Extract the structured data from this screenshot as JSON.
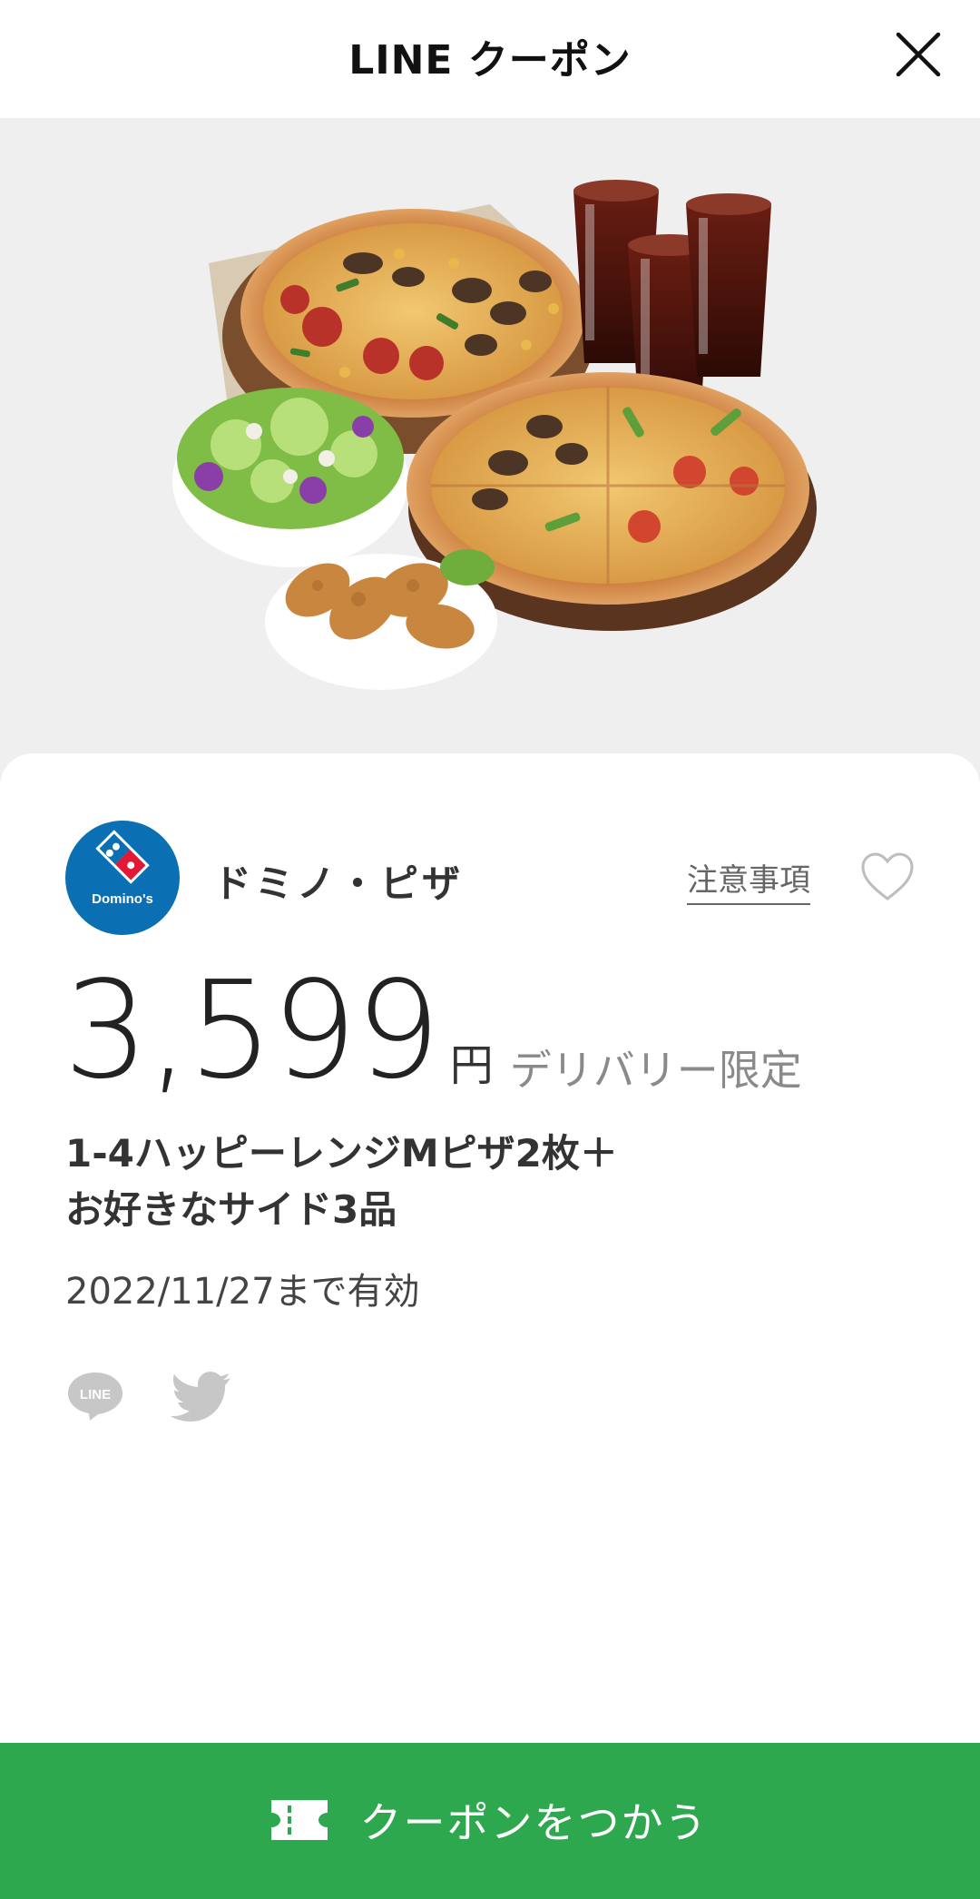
{
  "header": {
    "title": "LINE クーポン"
  },
  "hero": {
    "image": "pizza-set-photo"
  },
  "store": {
    "logo_text": "Domino's",
    "name": "ドミノ・ピザ"
  },
  "notice_label": "注意事項",
  "coupon": {
    "price": "3,599",
    "currency": "円",
    "condition": "デリバリー限定",
    "description": "1-4ハッピーレンジMピザ2枚＋お好きなサイド3品",
    "description_line1": "1-4ハッピーレンジMピザ2枚＋",
    "description_line2": "お好きなサイド3品",
    "valid_until": "2022/11/27まで有効"
  },
  "share": {
    "line_label": "LINE"
  },
  "cta": {
    "label": "クーポンをつかう"
  },
  "colors": {
    "accent_green": "#2ea84f",
    "dominos_blue": "#0a6fb3",
    "dominos_red": "#e31837",
    "hero_bg": "#efefef"
  }
}
